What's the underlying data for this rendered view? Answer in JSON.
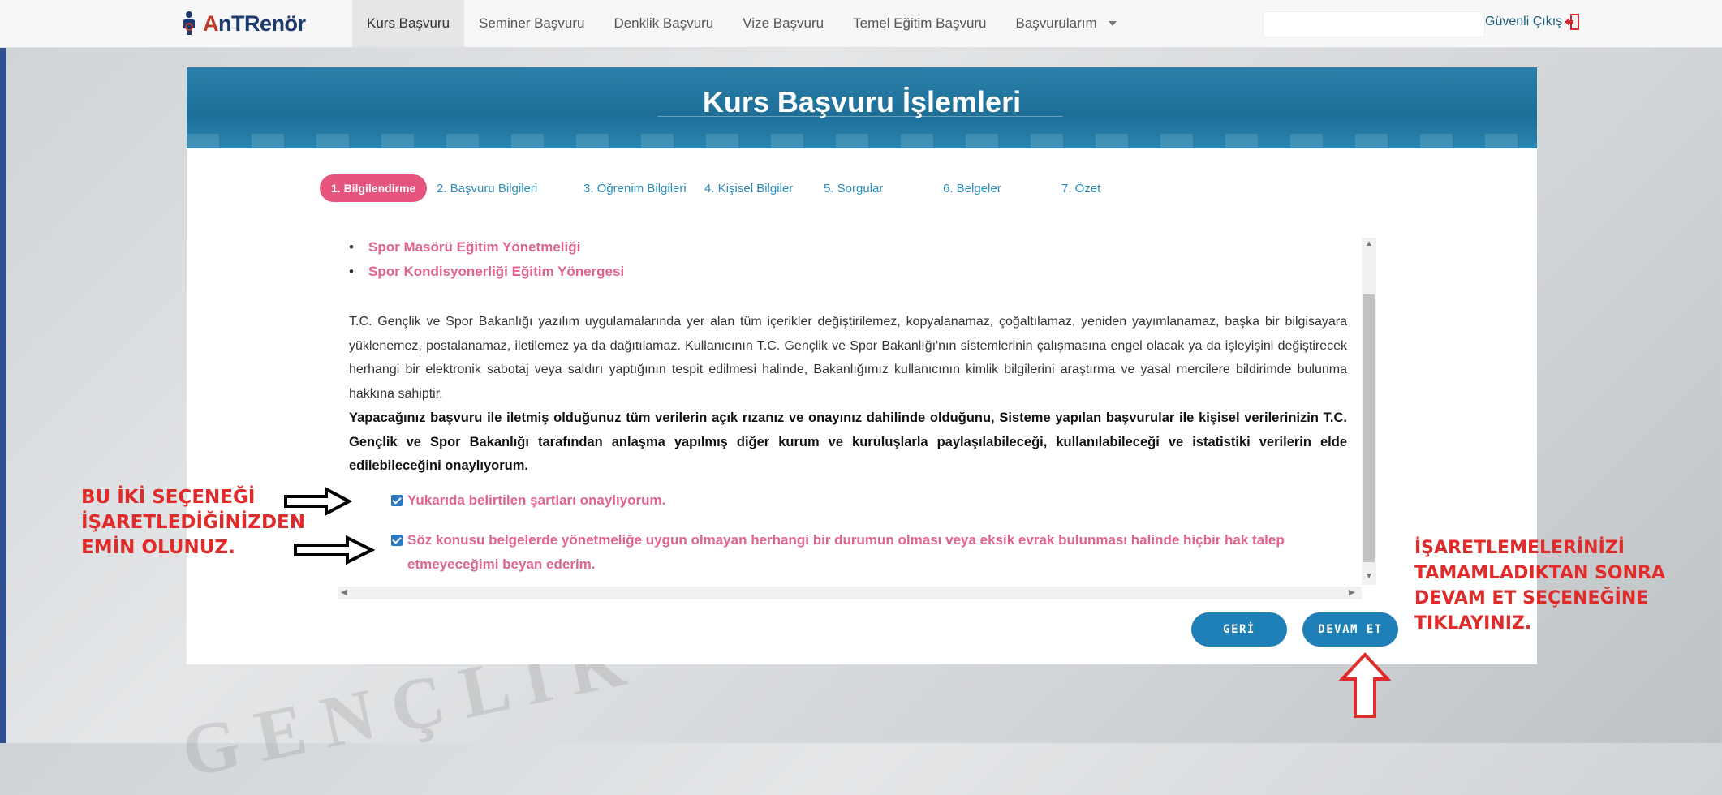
{
  "nav": {
    "logo_prefix": "A",
    "logo_rest": "nTRenör",
    "items": [
      {
        "label": "Kurs Başvuru"
      },
      {
        "label": "Seminer Başvuru"
      },
      {
        "label": "Denklik Başvuru"
      },
      {
        "label": "Vize Başvuru"
      },
      {
        "label": "Temel Eğitim Başvuru"
      },
      {
        "label": "Başvurularım"
      }
    ],
    "logout_label": "Güvenli Çıkış"
  },
  "page": {
    "title": "Kurs Başvuru İşlemleri"
  },
  "steps": [
    {
      "label": "1. Bilgilendirme",
      "active": true
    },
    {
      "label": "2. Başvuru Bilgileri"
    },
    {
      "label": "3. Öğrenim Bilgileri"
    },
    {
      "label": "4. Kişisel Bilgiler"
    },
    {
      "label": "5. Sorgular"
    },
    {
      "label": "6. Belgeler"
    },
    {
      "label": "7. Özet"
    }
  ],
  "content": {
    "links": [
      "Spor Masörü Eğitim Yönetmeliği",
      "Spor Kondisyonerliği Eğitim Yönergesi"
    ],
    "paragraph": "T.C. Gençlik ve Spor Bakanlığı yazılım uygulamalarında yer alan tüm içerikler değiştirilemez, kopyalanamaz, çoğaltılamaz, yeniden yayımlanamaz, başka bir bilgisayara yüklenemez, postalanamaz, iletilemez ya da dağıtılamaz. Kullanıcının T.C. Gençlik ve Spor Bakanlığı'nın sistemlerinin çalışmasına engel olacak ya da işleyişini değiştirecek herhangi bir elektronik sabotaj veya saldırı yaptığının tespit edilmesi halinde, Bakanlığımız kullanıcının kimlik bilgilerini araştırma ve yasal mercilere bildirimde bulunma hakkına sahiptir.",
    "consent": "Yapacağınız başvuru ile iletmiş olduğunuz tüm verilerin açık rızanız ve onayınız dahilinde olduğunu, Sisteme yapılan başvurular ile kişisel verilerinizin T.C. Gençlik ve Spor Bakanlığı tarafından anlaşma yapılmış diğer kurum ve kuruluşlarla paylaşılabileceği, kullanılabileceği ve istatistiki verilerin elde edilebileceğini onaylıyorum.",
    "checkbox1": "Yukarıda belirtilen şartları onaylıyorum.",
    "checkbox2": "Söz konusu belgelerde yönetmeliğe uygun olmayan herhangi bir durumun olması veya eksik evrak bulunması halinde hiçbir hak talep etmeyeceğimi beyan ederim.",
    "checkbox1_checked": true,
    "checkbox2_checked": true
  },
  "buttons": {
    "back": "GERİ",
    "next": "DEVAM ET"
  },
  "annotations": {
    "left": [
      "BU İKİ SEÇENEĞİ",
      "İŞARETLEDİĞİNİZDEN",
      "EMİN OLUNUZ."
    ],
    "right": [
      "İŞARETLEMELERİNİZİ",
      "TAMAMLADIKTAN SONRA",
      "DEVAM ET SEÇENEĞİNE",
      "TIKLAYINIZ."
    ],
    "color": "#e02b2b"
  },
  "colors": {
    "brand_blue": "#1f7fb7",
    "accent_pink": "#e6557d",
    "link_pink": "#e0658a"
  }
}
